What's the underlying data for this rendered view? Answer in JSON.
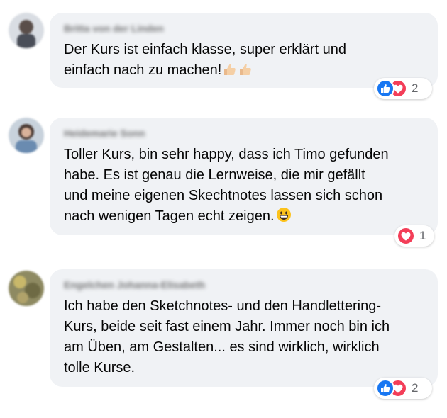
{
  "comments": [
    {
      "author": "Britta von der Linden",
      "text": "Der Kurs ist einfach klasse, super erklärt und\neinfach nach zu machen!",
      "reaction_count": "2",
      "reactions": [
        "like-icon",
        "love-icon"
      ]
    },
    {
      "author": "Heidemarie Sonn",
      "text": "Toller Kurs, bin sehr happy, dass ich Timo gefunden\nhabe. Es ist genau die Lernweise, die mir gefällt\nund meine eigenen Skechtnotes lassen sich schon\nnach wenigen Tagen echt zeigen.",
      "reaction_count": "1",
      "reactions": [
        "love-icon"
      ]
    },
    {
      "author": "Engelchen Johanna-Elisabeth",
      "text": "Ich habe den Sketchnotes- und den Handlettering-\nKurs, beide seit fast einem Jahr. Immer noch bin ich\nam Üben, am Gestalten... es sind wirklich, wirklich\ntolle Kurse.",
      "reaction_count": "2",
      "reactions": [
        "like-icon",
        "love-icon"
      ]
    }
  ],
  "colors": {
    "bubble": "#f0f2f5",
    "like": "#1877f2",
    "love": "#f33e58",
    "count": "#65676b"
  }
}
